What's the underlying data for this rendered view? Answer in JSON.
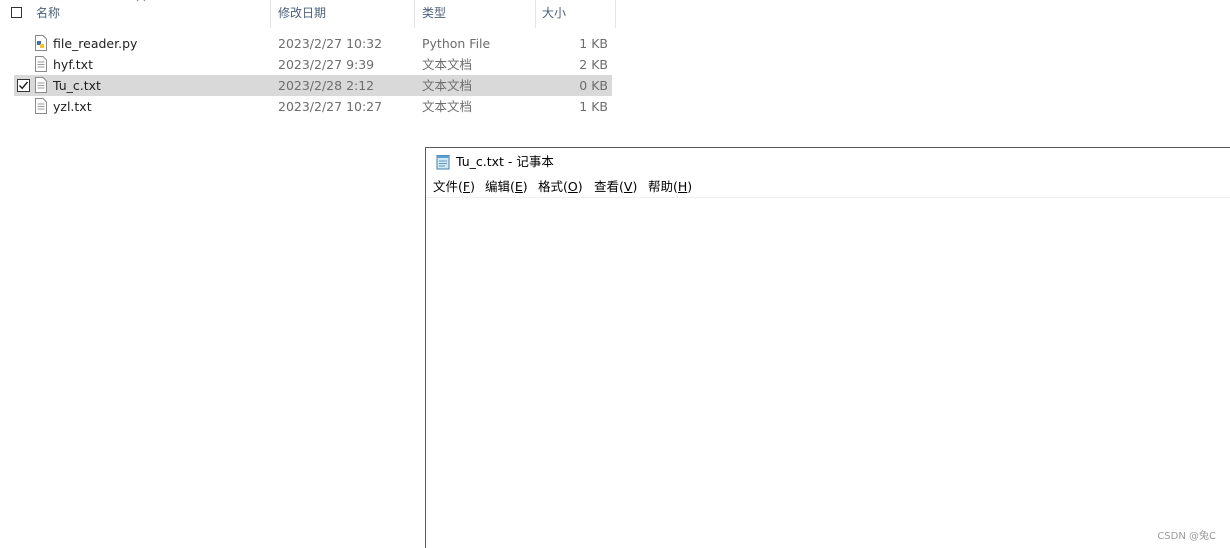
{
  "explorer": {
    "columns": {
      "name": "名称",
      "date": "修改日期",
      "type": "类型",
      "size": "大小"
    },
    "files": [
      {
        "name": "file_reader.py",
        "date": "2023/2/27 10:32",
        "type": "Python File",
        "size": "1 KB",
        "icon": "python-file-icon",
        "selected": false
      },
      {
        "name": "hyf.txt",
        "date": "2023/2/27 9:39",
        "type": "文本文档",
        "size": "2 KB",
        "icon": "text-file-icon",
        "selected": false
      },
      {
        "name": "Tu_c.txt",
        "date": "2023/2/28 2:12",
        "type": "文本文档",
        "size": "0 KB",
        "icon": "text-file-icon",
        "selected": true
      },
      {
        "name": "yzl.txt",
        "date": "2023/2/27 10:27",
        "type": "文本文档",
        "size": "1 KB",
        "icon": "text-file-icon",
        "selected": false
      }
    ]
  },
  "notepad": {
    "title": "Tu_c.txt - 记事本",
    "menu": [
      {
        "label": "文件(",
        "key": "F",
        "tail": ")"
      },
      {
        "label": "编辑(",
        "key": "E",
        "tail": ")"
      },
      {
        "label": "格式(",
        "key": "O",
        "tail": ")"
      },
      {
        "label": "查看(",
        "key": "V",
        "tail": ")"
      },
      {
        "label": "帮助(",
        "key": "H",
        "tail": ")"
      }
    ],
    "content": ""
  },
  "watermark": "CSDN @兔C"
}
